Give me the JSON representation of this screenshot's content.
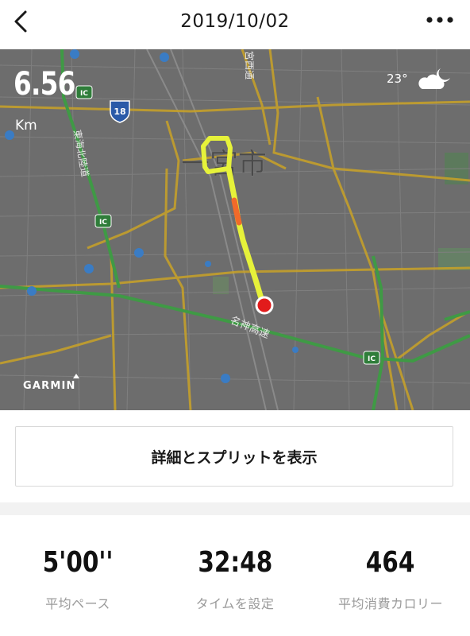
{
  "header": {
    "title": "2019/10/02",
    "back_icon": "chevron-left-icon",
    "more_icon": "more-horizontal-icon"
  },
  "map": {
    "distance_value": "6.56",
    "distance_unit": "Km",
    "temperature": "23°",
    "weather_icon": "cloud-moon-icon",
    "city_label": "一宮市",
    "road_label_expressway": "名神高速",
    "road_label_tokai": "東海北陸道",
    "road_label_miyanishi": "宮西通",
    "route_badge": "18",
    "ic_label": "IC",
    "garmin_logo": "GARMIN",
    "route_color_main": "#e6f23a",
    "route_color_fast": "#f06a2a",
    "end_marker_color": "#e21b1b"
  },
  "details_button_label": "詳細とスプリットを表示",
  "stats": [
    {
      "value": "5'00''",
      "label": "平均ペース"
    },
    {
      "value": "32:48",
      "label": "タイムを設定"
    },
    {
      "value": "464",
      "label": "平均消費カロリー"
    }
  ]
}
